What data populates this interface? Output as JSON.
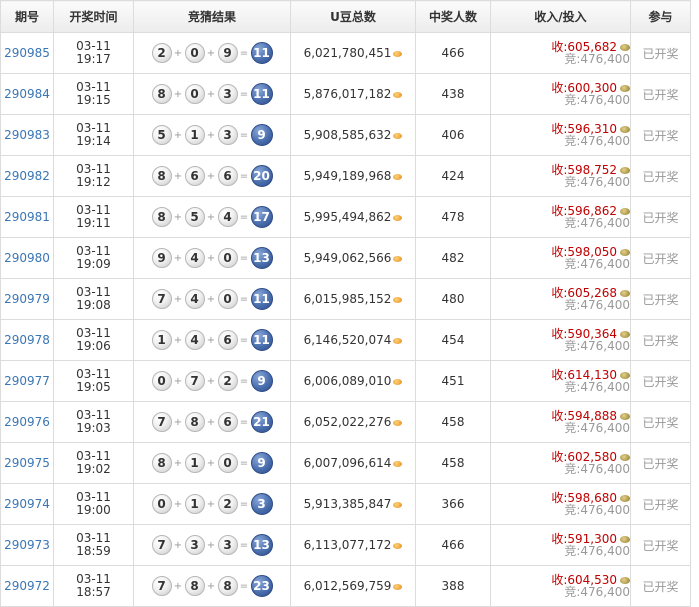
{
  "header": {
    "issue": "期号",
    "time": "开奖时间",
    "result": "竞猜结果",
    "pool": "U豆总数",
    "winners": "中奖人数",
    "income": "收入/投入",
    "join": "参与"
  },
  "rows": [
    {
      "issue": "290985",
      "date": "03-11",
      "time": "19:17",
      "balls": [
        "2",
        "0",
        "9"
      ],
      "sum": "11",
      "pool": "6,021,780,451",
      "winners": "466",
      "recv": "605,682",
      "bet": "476,400",
      "join": "已开奖"
    },
    {
      "issue": "290984",
      "date": "03-11",
      "time": "19:15",
      "balls": [
        "8",
        "0",
        "3"
      ],
      "sum": "11",
      "pool": "5,876,017,182",
      "winners": "438",
      "recv": "600,300",
      "bet": "476,400",
      "join": "已开奖"
    },
    {
      "issue": "290983",
      "date": "03-11",
      "time": "19:14",
      "balls": [
        "5",
        "1",
        "3"
      ],
      "sum": "9",
      "pool": "5,908,585,632",
      "winners": "406",
      "recv": "596,310",
      "bet": "476,400",
      "join": "已开奖"
    },
    {
      "issue": "290982",
      "date": "03-11",
      "time": "19:12",
      "balls": [
        "8",
        "6",
        "6"
      ],
      "sum": "20",
      "pool": "5,949,189,968",
      "winners": "424",
      "recv": "598,752",
      "bet": "476,400",
      "join": "已开奖"
    },
    {
      "issue": "290981",
      "date": "03-11",
      "time": "19:11",
      "balls": [
        "8",
        "5",
        "4"
      ],
      "sum": "17",
      "pool": "5,995,494,862",
      "winners": "478",
      "recv": "596,862",
      "bet": "476,400",
      "join": "已开奖"
    },
    {
      "issue": "290980",
      "date": "03-11",
      "time": "19:09",
      "balls": [
        "9",
        "4",
        "0"
      ],
      "sum": "13",
      "pool": "5,949,062,566",
      "winners": "482",
      "recv": "598,050",
      "bet": "476,400",
      "join": "已开奖"
    },
    {
      "issue": "290979",
      "date": "03-11",
      "time": "19:08",
      "balls": [
        "7",
        "4",
        "0"
      ],
      "sum": "11",
      "pool": "6,015,985,152",
      "winners": "480",
      "recv": "605,268",
      "bet": "476,400",
      "join": "已开奖"
    },
    {
      "issue": "290978",
      "date": "03-11",
      "time": "19:06",
      "balls": [
        "1",
        "4",
        "6"
      ],
      "sum": "11",
      "pool": "6,146,520,074",
      "winners": "454",
      "recv": "590,364",
      "bet": "476,400",
      "join": "已开奖"
    },
    {
      "issue": "290977",
      "date": "03-11",
      "time": "19:05",
      "balls": [
        "0",
        "7",
        "2"
      ],
      "sum": "9",
      "pool": "6,006,089,010",
      "winners": "451",
      "recv": "614,130",
      "bet": "476,400",
      "join": "已开奖"
    },
    {
      "issue": "290976",
      "date": "03-11",
      "time": "19:03",
      "balls": [
        "7",
        "8",
        "6"
      ],
      "sum": "21",
      "pool": "6,052,022,276",
      "winners": "458",
      "recv": "594,888",
      "bet": "476,400",
      "join": "已开奖"
    },
    {
      "issue": "290975",
      "date": "03-11",
      "time": "19:02",
      "balls": [
        "8",
        "1",
        "0"
      ],
      "sum": "9",
      "pool": "6,007,096,614",
      "winners": "458",
      "recv": "602,580",
      "bet": "476,400",
      "join": "已开奖"
    },
    {
      "issue": "290974",
      "date": "03-11",
      "time": "19:00",
      "balls": [
        "0",
        "1",
        "2"
      ],
      "sum": "3",
      "pool": "5,913,385,847",
      "winners": "366",
      "recv": "598,680",
      "bet": "476,400",
      "join": "已开奖"
    },
    {
      "issue": "290973",
      "date": "03-11",
      "time": "18:59",
      "balls": [
        "7",
        "3",
        "3"
      ],
      "sum": "13",
      "pool": "6,113,077,172",
      "winners": "466",
      "recv": "591,300",
      "bet": "476,400",
      "join": "已开奖"
    },
    {
      "issue": "290972",
      "date": "03-11",
      "time": "18:57",
      "balls": [
        "7",
        "8",
        "8"
      ],
      "sum": "23",
      "pool": "6,012,569,759",
      "winners": "388",
      "recv": "604,530",
      "bet": "476,400",
      "join": "已开奖"
    }
  ],
  "labels": {
    "recv_prefix": "收:",
    "bet_prefix": "竞:",
    "plus": "+",
    "equals": "="
  },
  "icons": {
    "pool": "coin-icon",
    "income": "bean-bag-icon"
  }
}
